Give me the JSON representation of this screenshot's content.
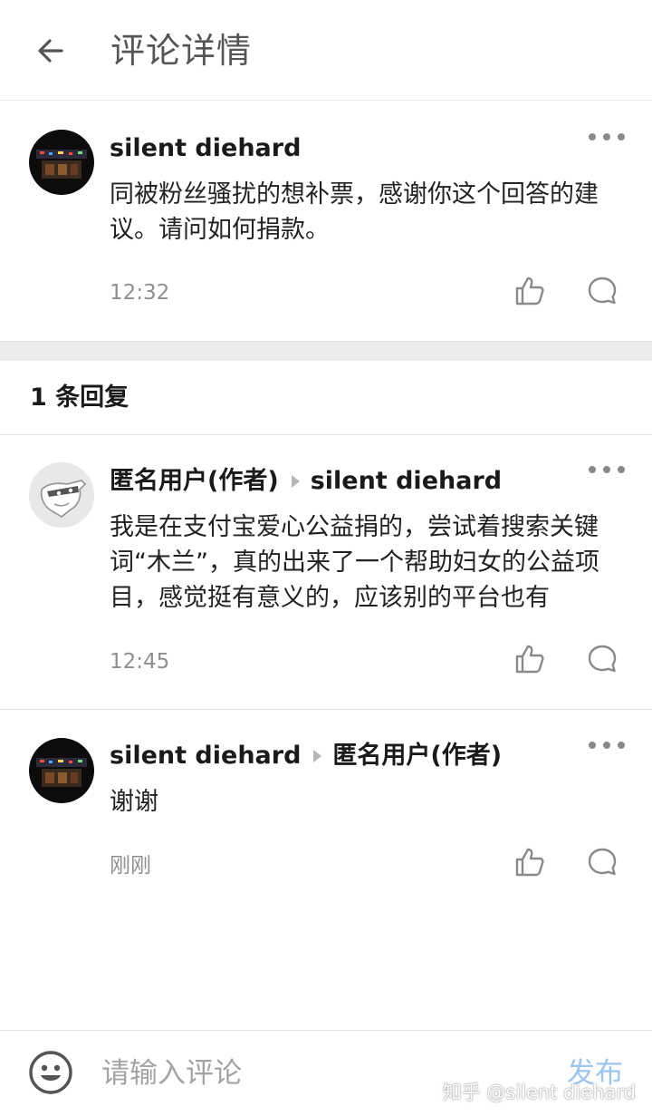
{
  "header": {
    "title": "评论详情"
  },
  "main_comment": {
    "author": "silent diehard",
    "text": "同被粉丝骚扰的想补票，感谢你这个回答的建议。请问如何捐款。",
    "time": "12:32"
  },
  "replies_section": {
    "count_label": "1 条回复"
  },
  "replies": [
    {
      "author": "匿名用户(作者)",
      "reply_to": "silent diehard",
      "text": "我是在支付宝爱心公益捐的，尝试着搜索关键词“木兰”，真的出来了一个帮助妇女的公益项目，感觉挺有意义的，应该别的平台也有",
      "time": "12:45"
    },
    {
      "author": "silent diehard",
      "reply_to": "匿名用户(作者)",
      "text": "谢谢",
      "time": "刚刚"
    }
  ],
  "input_bar": {
    "placeholder": "请输入评论",
    "publish_label": "发布",
    "watermark": "知乎 @silent diehard"
  },
  "icons": {
    "back": "arrow-left-icon",
    "more": "more-dots-icon",
    "like": "thumbs-up-icon",
    "reply": "comment-bubble-icon",
    "emoji": "smiley-icon"
  },
  "colors": {
    "publish": "#9dc6ef",
    "secondary_text": "#8f8f8f",
    "band": "#ebebeb"
  }
}
